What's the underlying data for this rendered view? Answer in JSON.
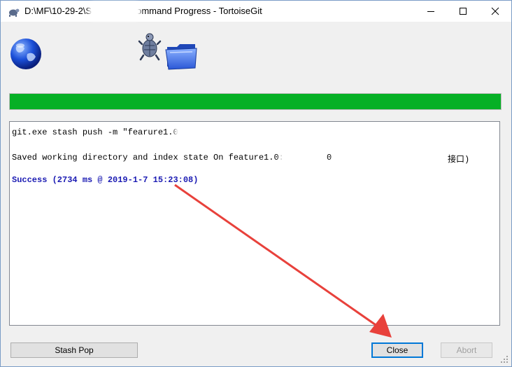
{
  "window": {
    "title_prefix": "D:\\MF\\10-29-2\\S",
    "title_suffix": "ommand Progress - TortoiseGit",
    "minimize_glyph": "—",
    "maximize_glyph": "☐",
    "close_glyph": "✕"
  },
  "icons": [
    "tortoisegit-app-icon",
    "globe-icon",
    "tortoise-icon",
    "folder-icon"
  ],
  "progress": {
    "fraction": 1.0,
    "color": "#06b025"
  },
  "log": {
    "lines": [
      {
        "text": "git.exe stash push -m \"fearure1.0",
        "style": "normal"
      },
      {
        "text": "Saved working directory and index state On feature1.0:",
        "style": "normal"
      },
      {
        "text": "Success (2734 ms @ 2019-1-7 15:23:08)",
        "style": "success"
      }
    ],
    "line2_fragment_a": "0",
    "line2_fragment_b": "接口)"
  },
  "buttons": {
    "stash_pop": "Stash Pop",
    "close": "Close",
    "abort": "Abort"
  },
  "colors": {
    "accent": "#0078d7",
    "success_text": "#1b1bb3",
    "annotation_arrow": "#e8413b"
  }
}
